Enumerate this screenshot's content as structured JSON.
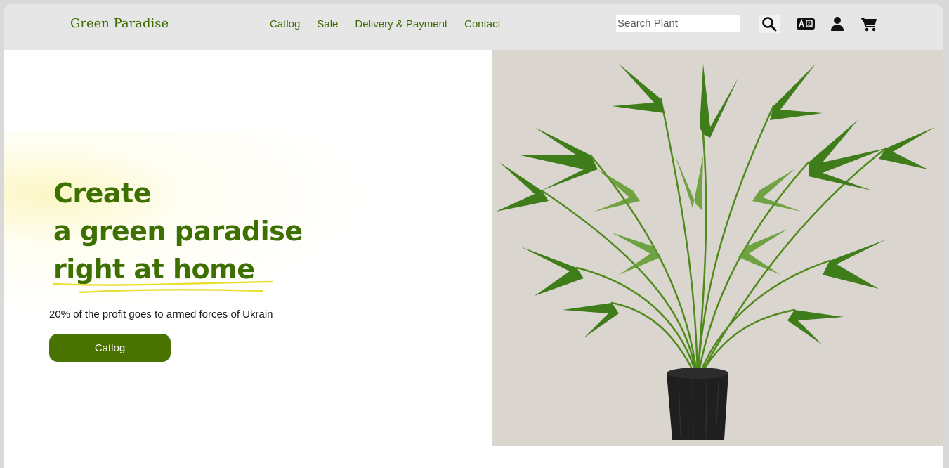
{
  "header": {
    "brand": "Green Paradise",
    "nav": [
      "Catlog",
      "Sale",
      "Delivery & Payment",
      "Contact"
    ],
    "search_placeholder": "Search Plant",
    "icons": [
      "search-icon",
      "language-icon",
      "user-icon",
      "cart-icon"
    ]
  },
  "hero": {
    "title_lines": [
      "Create",
      "a green paradise",
      "right at home"
    ],
    "subtitle": "20% of the profit goes to armed forces of Ukrain",
    "cta_label": "Catlog",
    "image": "potted-palm-plant"
  },
  "colors": {
    "brand_green": "#3d7000",
    "button_green": "#4a7200",
    "header_bg": "#e6e6e6",
    "image_bg": "#dbd5d0",
    "highlight_yellow": "#e8e030"
  }
}
